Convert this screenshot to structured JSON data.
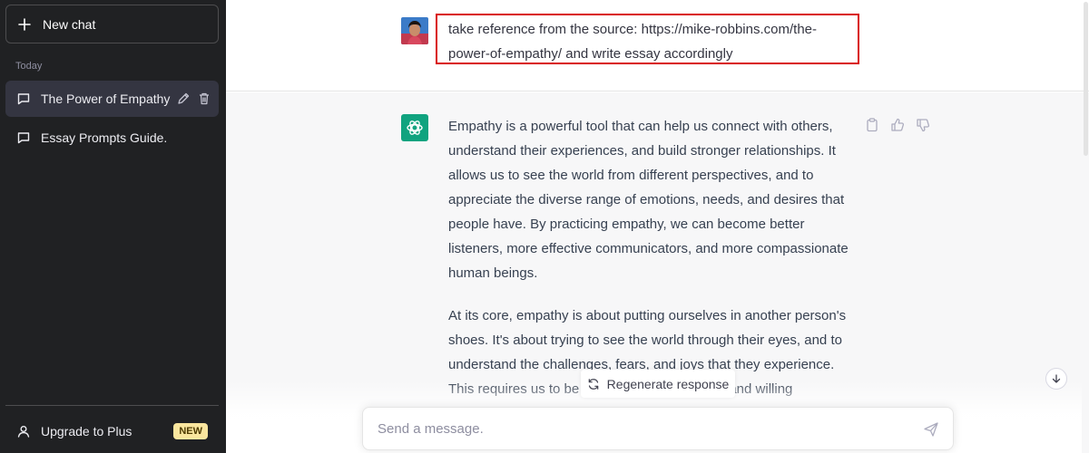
{
  "sidebar": {
    "new_chat_label": "New chat",
    "section_label": "Today",
    "conversations": [
      {
        "label": "The Power of Empathy",
        "active": true
      },
      {
        "label": "Essay Prompts Guide.",
        "active": false
      }
    ],
    "upgrade_label": "Upgrade to Plus",
    "new_badge": "NEW"
  },
  "thread": {
    "user_message": "take reference from the source: https://mike-robbins.com/the-power-of-empathy/ and write essay accordingly",
    "assistant_paragraphs": [
      "Empathy is a powerful tool that can help us connect with others, understand their experiences, and build stronger relationships. It allows us to see the world from different perspectives, and to appreciate the diverse range of emotions, needs, and desires that people have. By practicing empathy, we can become better listeners, more effective communicators, and more compassionate human beings.",
      "At its core, empathy is about putting ourselves in another person's shoes. It's about trying to see the world through their eyes, and to understand the challenges, fears, and joys that they experience. This requires us to be open-minded, attentive, and willing"
    ]
  },
  "controls": {
    "regenerate_label": "Regenerate response",
    "composer_placeholder": "Send a message."
  },
  "icons": {
    "new_chat": "plus-icon",
    "conversation": "chat-bubble-icon",
    "edit": "pencil-icon",
    "delete": "trash-icon",
    "user": "user-icon",
    "copy": "clipboard-icon",
    "thumbs_up": "thumbs-up-icon",
    "thumbs_down": "thumbs-down-icon",
    "regenerate": "refresh-icon",
    "scroll_down": "arrow-down-icon",
    "send": "paper-plane-icon"
  },
  "colors": {
    "sidebar_bg": "#202123",
    "active_item_bg": "#343541",
    "assistant_avatar": "#10a37f",
    "highlight_box": "#d90f0f",
    "new_badge_bg": "#fae69e"
  }
}
